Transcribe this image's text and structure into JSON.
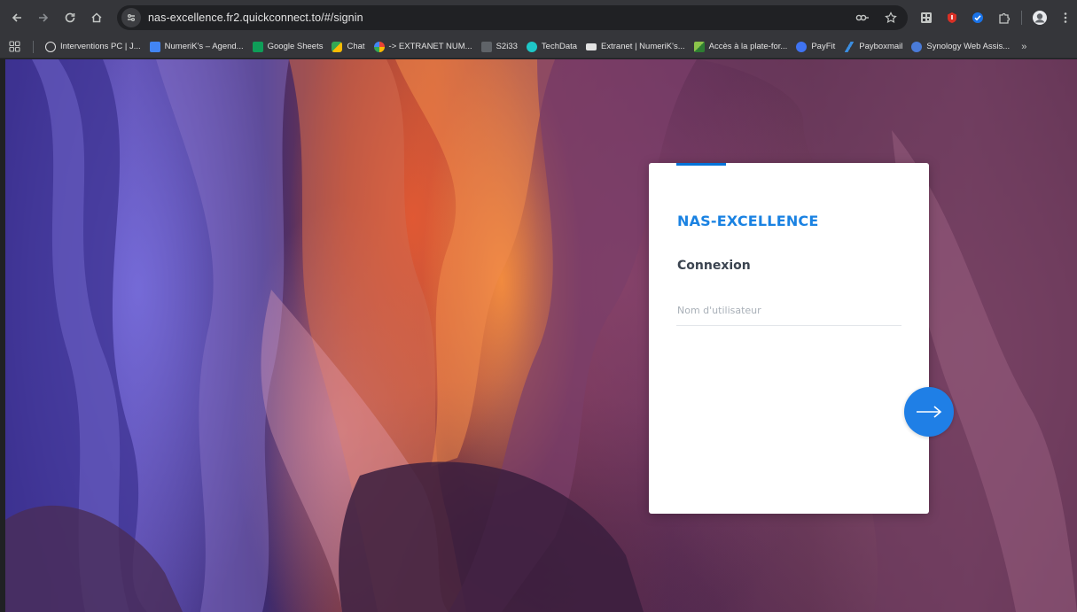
{
  "browser": {
    "url": "nas-excellence.fr2.quickconnect.to/#/signin",
    "bookmarks": [
      {
        "label": "Interventions PC | J...",
        "icon": "globe-icon",
        "color": "#e3e3e3"
      },
      {
        "label": "NumeriK's – Agend...",
        "icon": "calendar-icon",
        "color": "#4285f4"
      },
      {
        "label": "Google Sheets",
        "icon": "sheets-icon",
        "color": "#0f9d58"
      },
      {
        "label": "Chat",
        "icon": "chat-icon",
        "color": "#34a853"
      },
      {
        "label": "-> EXTRANET NUM...",
        "icon": "google-icon",
        "color": "#ffffff"
      },
      {
        "label": "S2i33",
        "icon": "s2i33-icon",
        "color": "#5f6368"
      },
      {
        "label": "TechData",
        "icon": "techdata-icon",
        "color": "#1ec7c7"
      },
      {
        "label": "Extranet | NumeriK's...",
        "icon": "extranet-icon",
        "color": "#e3e3e3"
      },
      {
        "label": "Accès à la plate-for...",
        "icon": "plateform-icon",
        "color": "#8bc34a"
      },
      {
        "label": "PayFit",
        "icon": "payfit-icon",
        "color": "#3f73f2"
      },
      {
        "label": "Payboxmail",
        "icon": "payboxmail-icon",
        "color": "#3b8de0"
      },
      {
        "label": "Synology Web Assis...",
        "icon": "synology-icon",
        "color": "#4a7bd8"
      }
    ],
    "more_label": "»"
  },
  "login": {
    "brand": "NAS-EXCELLENCE",
    "title": "Connexion",
    "username_placeholder": "Nom d'utilisateur",
    "username_value": "",
    "accent_color": "#0073d9"
  }
}
